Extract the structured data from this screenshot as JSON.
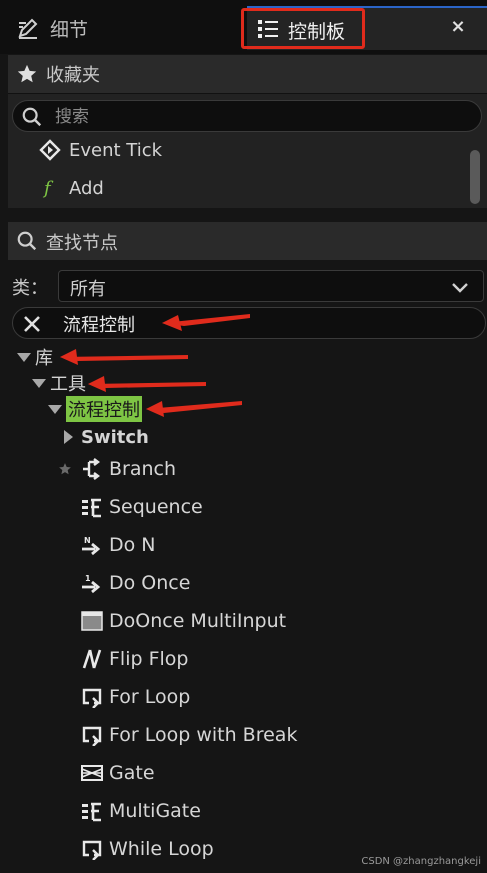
{
  "tabs": {
    "details_label": "细节",
    "palette_label": "控制板",
    "close_label": "×"
  },
  "favorites": {
    "title": "收藏夹",
    "search_placeholder": "搜索",
    "items": [
      {
        "label": "Event Tick",
        "icon": "event-icon"
      },
      {
        "label": "Add",
        "icon": "function-icon"
      }
    ]
  },
  "find_node": {
    "title": "查找节点",
    "category_label": "类：",
    "category_value": "所有",
    "filter_value": "流程控制"
  },
  "tree": {
    "level1": "库",
    "level2": "工具",
    "level3": "流程控制",
    "switch_label": "Switch",
    "nodes": [
      {
        "label": "Branch",
        "icon": "branch-icon"
      },
      {
        "label": "Sequence",
        "icon": "sequence-icon"
      },
      {
        "label": "Do N",
        "icon": "do-n-icon"
      },
      {
        "label": "Do Once",
        "icon": "do-once-icon"
      },
      {
        "label": "DoOnce MultiInput",
        "icon": "doonce-multiinput-icon"
      },
      {
        "label": "Flip Flop",
        "icon": "flip-flop-icon"
      },
      {
        "label": "For Loop",
        "icon": "for-loop-icon"
      },
      {
        "label": "For Loop with Break",
        "icon": "for-loop-break-icon"
      },
      {
        "label": "Gate",
        "icon": "gate-icon"
      },
      {
        "label": "MultiGate",
        "icon": "multigate-icon"
      },
      {
        "label": "While Loop",
        "icon": "while-loop-icon"
      }
    ]
  },
  "watermark": "CSDN @zhangzhangkeji",
  "colors": {
    "highlight": "#7ec544",
    "annotation_red": "#e02b1c",
    "active_tab_accent": "#2b65c8"
  }
}
